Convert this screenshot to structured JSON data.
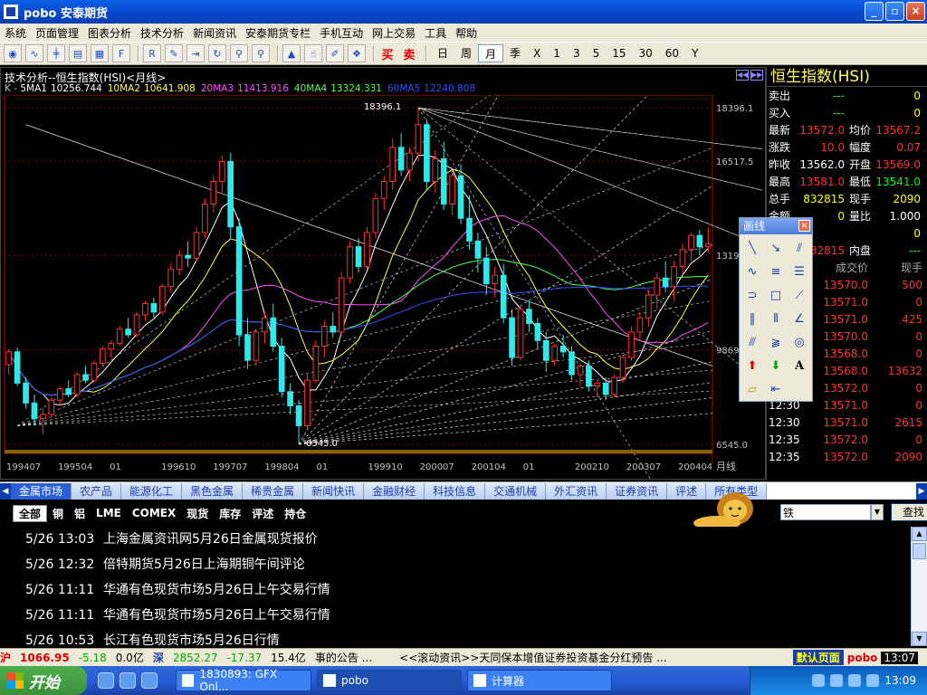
{
  "window": {
    "title": "pobo 安泰期货",
    "controls": [
      "_",
      "▫",
      "×"
    ]
  },
  "menu": [
    "系统",
    "页面管理",
    "图表分析",
    "技术分析",
    "新闻资讯",
    "安泰期货专栏",
    "手机互动",
    "网上交易",
    "工具",
    "帮助"
  ],
  "toolbar": {
    "buy": "买",
    "sell": "卖",
    "periods": [
      "日",
      "周",
      "月",
      "季",
      "X",
      "1",
      "3",
      "5",
      "15",
      "30",
      "60",
      "Y"
    ],
    "active_period": "月"
  },
  "chart": {
    "header": "技术分析--恒生指数(HSI)<月线>",
    "nav_icons": [
      "◀◀",
      "▶▶"
    ],
    "ma_label": "K - ",
    "ma": [
      {
        "label": "5MA1",
        "value": "10256.744",
        "color": "#ffffff"
      },
      {
        "label": "10MA2",
        "value": "10641.908",
        "color": "#ffff50"
      },
      {
        "label": "20MA3",
        "value": "11413.916",
        "color": "#ff50ff"
      },
      {
        "label": "40MA4",
        "value": "13324.331",
        "color": "#50ff50"
      },
      {
        "label": "60MA5",
        "value": "12240.808",
        "color": "#3050ff"
      }
    ],
    "period_label": "月线",
    "high_label": "18396.1",
    "low_label": "6545.0",
    "colors": {
      "up": "#ff3030",
      "down": "#30e8e8",
      "grid": "#800000",
      "axis": "#c00000",
      "text": "#c0c0c0"
    }
  },
  "chart_data": {
    "type": "candlestick",
    "ylim": [
      6545.0,
      18396.1
    ],
    "yticks": [
      "18396.1",
      "16517.5",
      "13197",
      "9869",
      "6545.0"
    ],
    "xticks": [
      "199407",
      "199504",
      "01",
      "199610",
      "199707",
      "199804",
      "01",
      "199910",
      "200007",
      "200104",
      "01",
      "200210",
      "200307",
      "200404"
    ],
    "series": [
      {
        "name": "K",
        "type": "ohlc",
        "values": [
          [
            9350,
            9900,
            9000,
            9800
          ],
          [
            9800,
            9950,
            8600,
            8700
          ],
          [
            8700,
            8900,
            7800,
            8000
          ],
          [
            8000,
            8300,
            7200,
            7450
          ],
          [
            7450,
            7800,
            6900,
            7600
          ],
          [
            7600,
            8200,
            7500,
            8100
          ],
          [
            8100,
            8600,
            7900,
            8500
          ],
          [
            8500,
            8800,
            8200,
            8300
          ],
          [
            8300,
            9100,
            8200,
            9000
          ],
          [
            9000,
            9300,
            8700,
            8800
          ],
          [
            8800,
            9500,
            8700,
            9400
          ],
          [
            9400,
            10000,
            9300,
            9900
          ],
          [
            9900,
            10200,
            9600,
            10100
          ],
          [
            10100,
            10700,
            10000,
            10600
          ],
          [
            10600,
            11000,
            10300,
            10400
          ],
          [
            10400,
            11200,
            10300,
            11100
          ],
          [
            11100,
            11600,
            10900,
            11500
          ],
          [
            11500,
            11700,
            11000,
            11200
          ],
          [
            11200,
            12200,
            11100,
            12100
          ],
          [
            12100,
            12900,
            11900,
            12700
          ],
          [
            12700,
            13400,
            12500,
            13200
          ],
          [
            13200,
            13700,
            12800,
            13100
          ],
          [
            13100,
            14200,
            13000,
            14000
          ],
          [
            14000,
            15200,
            13800,
            15000
          ],
          [
            15000,
            16000,
            14700,
            15800
          ],
          [
            15800,
            16700,
            15400,
            16500
          ],
          [
            16500,
            16800,
            13800,
            14200
          ],
          [
            14200,
            14500,
            10000,
            10400
          ],
          [
            10400,
            11000,
            9200,
            9500
          ],
          [
            9500,
            10600,
            9300,
            10500
          ],
          [
            10500,
            11200,
            10100,
            11000
          ],
          [
            11000,
            11500,
            9800,
            10000
          ],
          [
            10000,
            10300,
            8200,
            8400
          ],
          [
            8400,
            8700,
            7600,
            7900
          ],
          [
            7900,
            8100,
            6545,
            7200
          ],
          [
            7200,
            9000,
            7100,
            8800
          ],
          [
            8800,
            10200,
            8700,
            10000
          ],
          [
            10000,
            10900,
            9600,
            10700
          ],
          [
            10700,
            11200,
            10300,
            10500
          ],
          [
            10500,
            12600,
            10400,
            12400
          ],
          [
            12400,
            13700,
            12200,
            13500
          ],
          [
            13500,
            13800,
            12600,
            12800
          ],
          [
            12800,
            14200,
            12700,
            14000
          ],
          [
            14000,
            15400,
            13800,
            15200
          ],
          [
            15200,
            16000,
            14800,
            15800
          ],
          [
            15800,
            17300,
            15500,
            17000
          ],
          [
            17000,
            17500,
            16000,
            16200
          ],
          [
            16200,
            17000,
            15800,
            16800
          ],
          [
            16800,
            18396.1,
            16500,
            17800
          ],
          [
            17800,
            18000,
            15500,
            15800
          ],
          [
            15800,
            16900,
            15400,
            16600
          ],
          [
            16600,
            17200,
            14800,
            15000
          ],
          [
            15000,
            16200,
            14600,
            16000
          ],
          [
            16000,
            16400,
            14300,
            14500
          ],
          [
            14500,
            15300,
            13400,
            13700
          ],
          [
            13700,
            14000,
            12600,
            13100
          ],
          [
            13100,
            13500,
            11800,
            12200
          ],
          [
            12200,
            12800,
            11700,
            12500
          ],
          [
            12500,
            12900,
            10800,
            11000
          ],
          [
            11000,
            11300,
            9300,
            9600
          ],
          [
            9600,
            11400,
            9500,
            11300
          ],
          [
            11300,
            11600,
            10500,
            10800
          ],
          [
            10800,
            11000,
            9900,
            10200
          ],
          [
            10200,
            10500,
            9100,
            9500
          ],
          [
            9500,
            10100,
            9300,
            10000
          ],
          [
            10000,
            10400,
            9600,
            9800
          ],
          [
            9800,
            10000,
            8800,
            9000
          ],
          [
            9000,
            9400,
            8600,
            9300
          ],
          [
            9300,
            9500,
            8400,
            8600
          ],
          [
            8600,
            8800,
            8200,
            8700
          ],
          [
            8700,
            8900,
            8100,
            8300
          ],
          [
            8300,
            9000,
            8200,
            8900
          ],
          [
            8900,
            9700,
            8700,
            9600
          ],
          [
            9600,
            10700,
            9500,
            10500
          ],
          [
            10500,
            11200,
            10200,
            11000
          ],
          [
            11000,
            12000,
            10700,
            11800
          ],
          [
            11800,
            12600,
            11300,
            12400
          ],
          [
            12400,
            13000,
            11900,
            12100
          ],
          [
            12100,
            13000,
            11600,
            12800
          ],
          [
            12800,
            13600,
            12500,
            13400
          ],
          [
            13400,
            14000,
            13000,
            13900
          ],
          [
            13900,
            14100,
            13200,
            13500
          ],
          [
            13500,
            14200,
            13300,
            13600
          ]
        ]
      }
    ]
  },
  "quote": {
    "title": "恒生指数(HSI)",
    "rows": [
      {
        "l1": "卖出",
        "v1": "---",
        "l2": "",
        "v2": "0",
        "c1": "#00ff00",
        "c2": "#ffff00"
      },
      {
        "l1": "买入",
        "v1": "---",
        "l2": "",
        "v2": "0",
        "c1": "#00ff00",
        "c2": "#ffff00"
      },
      {
        "l1": "最新",
        "v1": "13572.0",
        "l2": "均价",
        "v2": "13567.2",
        "c1": "#ff3030",
        "c2": "#ff3030"
      },
      {
        "l1": "涨跌",
        "v1": "10.0",
        "l2": "幅度",
        "v2": "0.07",
        "c1": "#ff3030",
        "c2": "#ff3030"
      },
      {
        "l1": "昨收",
        "v1": "13562.0",
        "l2": "开盘",
        "v2": "13569.0",
        "c1": "#ffffff",
        "c2": "#ff3030"
      },
      {
        "l1": "最高",
        "v1": "13581.0",
        "l2": "最低",
        "v2": "13541.0",
        "c1": "#ff3030",
        "c2": "#00ff00"
      },
      {
        "l1": "总手",
        "v1": "832815",
        "l2": "现手",
        "v2": "2090",
        "c1": "#ffff00",
        "c2": "#ffff00"
      },
      {
        "l1": "金额",
        "v1": "0",
        "l2": "量比",
        "v2": "1.000",
        "c1": "#ffff00",
        "c2": "#ffffff"
      },
      {
        "l1": "",
        "v1": "",
        "l2": "",
        "v2": "0",
        "c1": "#ffffff",
        "c2": "#ffff00"
      },
      {
        "l1": "",
        "v1": "832815",
        "l2": "内盘",
        "v2": "---",
        "c1": "#ff3030",
        "c2": "#00ff00"
      }
    ],
    "ticks_header": {
      "price": "成交价",
      "vol": "现手"
    },
    "ticks": [
      {
        "t": "",
        "p": "13570.0",
        "v": "500"
      },
      {
        "t": "",
        "p": "13571.0",
        "v": "0"
      },
      {
        "t": "",
        "p": "13571.0",
        "v": "425"
      },
      {
        "t": "",
        "p": "13570.0",
        "v": "0"
      },
      {
        "t": "",
        "p": "13568.0",
        "v": "0"
      },
      {
        "t": "",
        "p": "13568.0",
        "v": "13632"
      },
      {
        "t": "",
        "p": "13572.0",
        "v": "0"
      },
      {
        "t": "12:30",
        "p": "13571.0",
        "v": "0"
      },
      {
        "t": "12:30",
        "p": "13571.0",
        "v": "2615"
      },
      {
        "t": "12:35",
        "p": "13572.0",
        "v": "0"
      },
      {
        "t": "12:35",
        "p": "13572.0",
        "v": "2090"
      }
    ]
  },
  "palette": {
    "title": "画线",
    "close": "×",
    "text_tool": "A"
  },
  "categories": [
    "金属市场",
    "农产品",
    "能源化工",
    "黑色金属",
    "稀贵金属",
    "新闻快讯",
    "金融财经",
    "科技信息",
    "交通机械",
    "外汇资讯",
    "证券资讯",
    "评述",
    "所有类型"
  ],
  "subtabs": [
    "全部",
    "铜",
    "铝",
    "LME",
    "COMEX",
    "现货",
    "库存",
    "评述",
    "持仓"
  ],
  "search": {
    "value": "铁",
    "button": "查找"
  },
  "news": [
    {
      "date": "5/26 13:03",
      "title": "上海金属资讯网5月26日金属现货报价"
    },
    {
      "date": "5/26 12:32",
      "title": "倍特期货5月26日上海期铜午间评论"
    },
    {
      "date": "5/26 11:11",
      "title": "华通有色现货市场5月26日上午交易行情"
    },
    {
      "date": "5/26 11:11",
      "title": "华通有色现货市场5月26日上午交易行情"
    },
    {
      "date": "5/26 10:53",
      "title": "长江有色现货市场5月26日行情"
    }
  ],
  "status": {
    "sh_label": "沪",
    "sh_value": "1066.95",
    "sh_change": "-5.18",
    "sh_vol": "0.0亿",
    "sz_label": "深",
    "sz_value": "2852.27",
    "sz_change": "-17.37",
    "sz_vol": "15.4亿",
    "ticker1": "事的公告 ...",
    "ticker2": "<<滚动资讯>>天同保本增值证券投资基金分红预告 ...",
    "default_page": "默认页面",
    "logo": "pobo",
    "clock": "13:07"
  },
  "taskbar": {
    "start": "开始",
    "tasks": [
      "1830893: GFX Onl...",
      "pobo",
      "计算器"
    ],
    "active_task": 1,
    "time": "13:09"
  }
}
